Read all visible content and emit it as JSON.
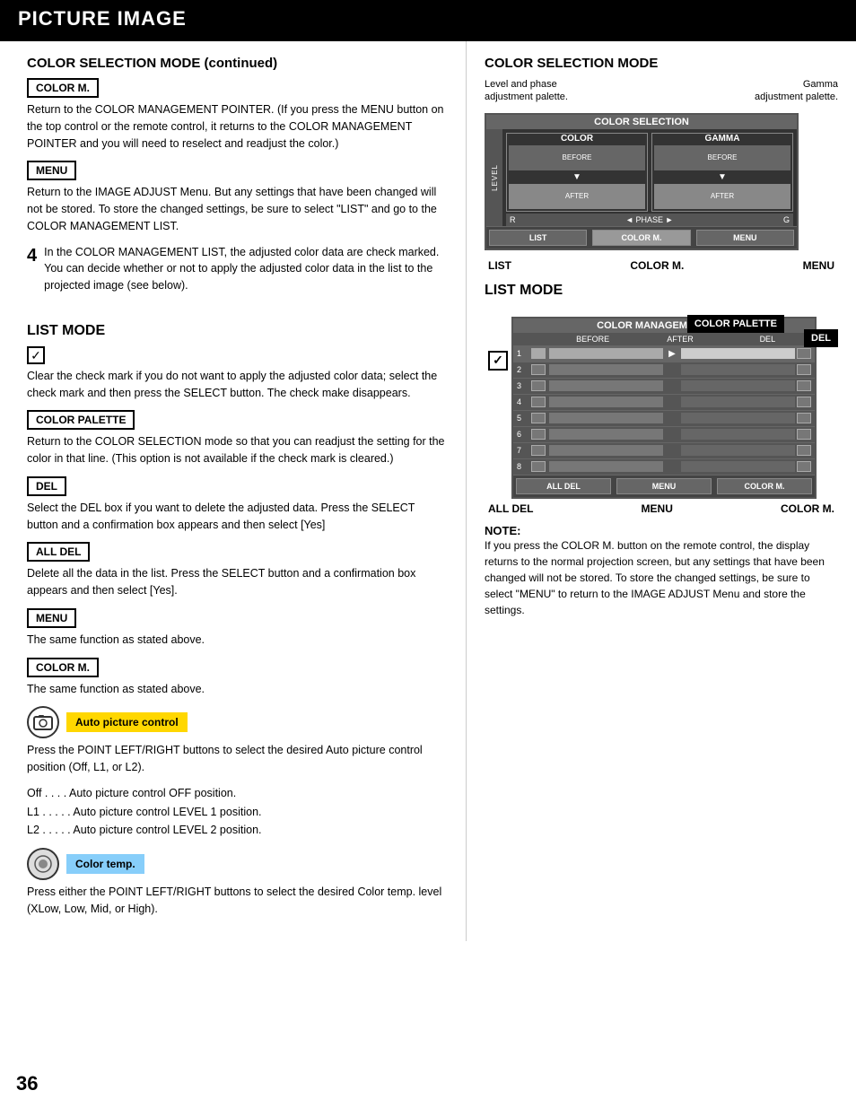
{
  "header": {
    "title": "PICTURE IMAGE",
    "page_number": "36"
  },
  "left": {
    "section1_title": "COLOR SELECTION MODE (continued)",
    "color_m_label": "COLOR M.",
    "color_m_desc": "Return to the COLOR MANAGEMENT POINTER. (If you press the MENU button on the top control or the remote control, it returns to the COLOR MANAGEMENT POINTER and you will need to reselect and readjust the color.)",
    "menu_label": "MENU",
    "menu_desc": "Return to the IMAGE ADJUST Menu. But any settings that have been changed will not be stored. To store the changed settings, be sure to select \"LIST\" and go to the COLOR MANAGEMENT LIST.",
    "step4_number": "4",
    "step4_desc": "In the COLOR MANAGEMENT LIST, the adjusted color data are check marked. You can decide whether or not to apply the adjusted color data in the list to the projected image (see below).",
    "list_mode_title": "LIST MODE",
    "checkmark_symbol": "✓",
    "checkmark_desc": "Clear the check mark if you do not want to apply the adjusted color data; select the check mark and then press the SELECT button. The check make disappears.",
    "color_palette_label": "COLOR PALETTE",
    "color_palette_desc": "Return to the COLOR SELECTION mode so that you can readjust the setting for the color in that line. (This option is not available if the check mark is cleared.)",
    "del_label": "DEL",
    "del_desc": "Select the DEL box if you want to delete the adjusted data. Press the SELECT button and a confirmation box appears and then select [Yes]",
    "all_del_label": "ALL DEL",
    "all_del_desc": "Delete all the data in the list. Press the SELECT button and a confirmation box appears and then select [Yes].",
    "menu2_label": "MENU",
    "menu2_desc": "The same function as stated above.",
    "color_m2_label": "COLOR M.",
    "color_m2_desc": "The same function as stated above.",
    "auto_picture_label": "Auto picture control",
    "auto_picture_desc": "Press the POINT LEFT/RIGHT buttons to select the desired Auto picture control position (Off, L1, or L2).",
    "auto_picture_off": "Off  . . . . Auto picture control OFF position.",
    "auto_picture_l1": "L1  . . . . . Auto picture control LEVEL 1 position.",
    "auto_picture_l2": "L2  . . . . . Auto picture control LEVEL 2 position.",
    "color_temp_label": "Color temp.",
    "color_temp_desc": "Press either the POINT LEFT/RIGHT buttons to select the desired Color temp. level (XLow, Low, Mid, or High)."
  },
  "right": {
    "section2_title": "COLOR SELECTION MODE",
    "level_phase_label": "Level and phase\nadjustment palette.",
    "gamma_label": "Gamma\nadjustment palette.",
    "diagram": {
      "header": "COLOR SELECTION",
      "col1_title": "COLOR",
      "col2_title": "GAMMA",
      "before_label": "BEFORE",
      "after_label": "AFTER",
      "level_label": "LEVEL",
      "phase_label": "◄ PHASE ►",
      "list_btn": "LIST",
      "color_m_btn": "COLOR M.",
      "menu_btn": "MENU",
      "r_label": "R",
      "g_label": "G"
    },
    "bottom_labels": {
      "list": "LIST",
      "color_m": "COLOR M.",
      "menu": "MENU"
    },
    "list_mode_title": "LIST MODE",
    "list_diagram": {
      "color_palette_callout": "COLOR PALETTE",
      "del_callout": "DEL",
      "header": "COLOR MANAGEMENT LIST",
      "col_before": "BEFORE",
      "col_after": "AFTER",
      "col_del": "DEL",
      "rows": [
        "1",
        "2",
        "3",
        "4",
        "5",
        "6",
        "7",
        "8"
      ],
      "bottom_all_del": "ALL DEL",
      "bottom_menu": "MENU",
      "bottom_color_m": "COLOR M."
    },
    "outer_labels": {
      "all_del": "ALL DEL",
      "menu": "MENU",
      "color_m": "COLOR M."
    },
    "note_title": "NOTE:",
    "note_text": "If you press the COLOR M. button on the remote control, the display returns to the normal projection screen, but any settings that have been changed will not be stored. To store the changed settings, be sure to select \"MENU\" to return to the IMAGE ADJUST Menu and store the settings."
  }
}
